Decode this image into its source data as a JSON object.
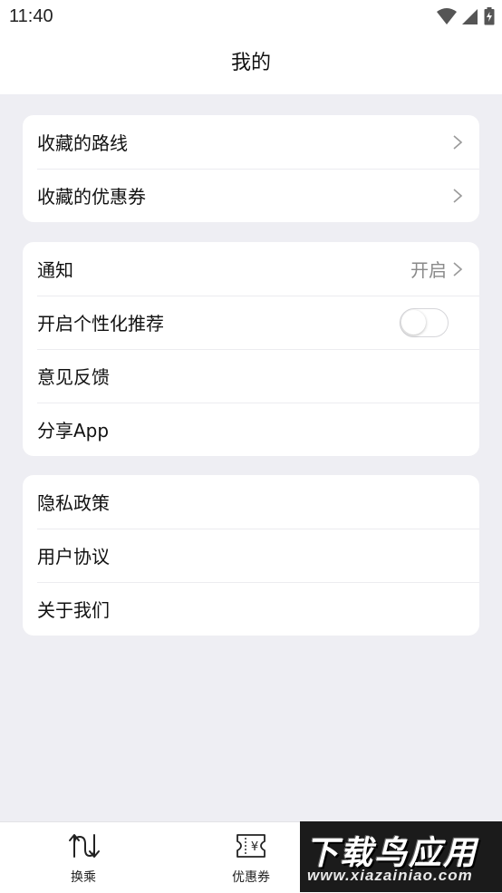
{
  "status_bar": {
    "time": "11:40"
  },
  "header": {
    "title": "我的"
  },
  "section1": {
    "items": [
      {
        "label": "收藏的路线"
      },
      {
        "label": "收藏的优惠券"
      }
    ]
  },
  "section2": {
    "items": [
      {
        "label": "通知",
        "value": "开启"
      },
      {
        "label": "开启个性化推荐",
        "toggle_on": false
      },
      {
        "label": "意见反馈"
      },
      {
        "label": "分享App"
      }
    ]
  },
  "section3": {
    "items": [
      {
        "label": "隐私政策"
      },
      {
        "label": "用户协议"
      },
      {
        "label": "关于我们"
      }
    ]
  },
  "tabbar": {
    "tabs": [
      {
        "label": "换乘",
        "icon": "transfer-icon"
      },
      {
        "label": "优惠券",
        "icon": "coupon-icon"
      }
    ]
  },
  "watermark": {
    "title": "下载鸟应用",
    "url": "www.xiazainiao.com"
  },
  "colors": {
    "background": "#eeeef3",
    "card": "#ffffff",
    "secondary_text": "#8a8a8a",
    "divider": "#ececf0"
  }
}
